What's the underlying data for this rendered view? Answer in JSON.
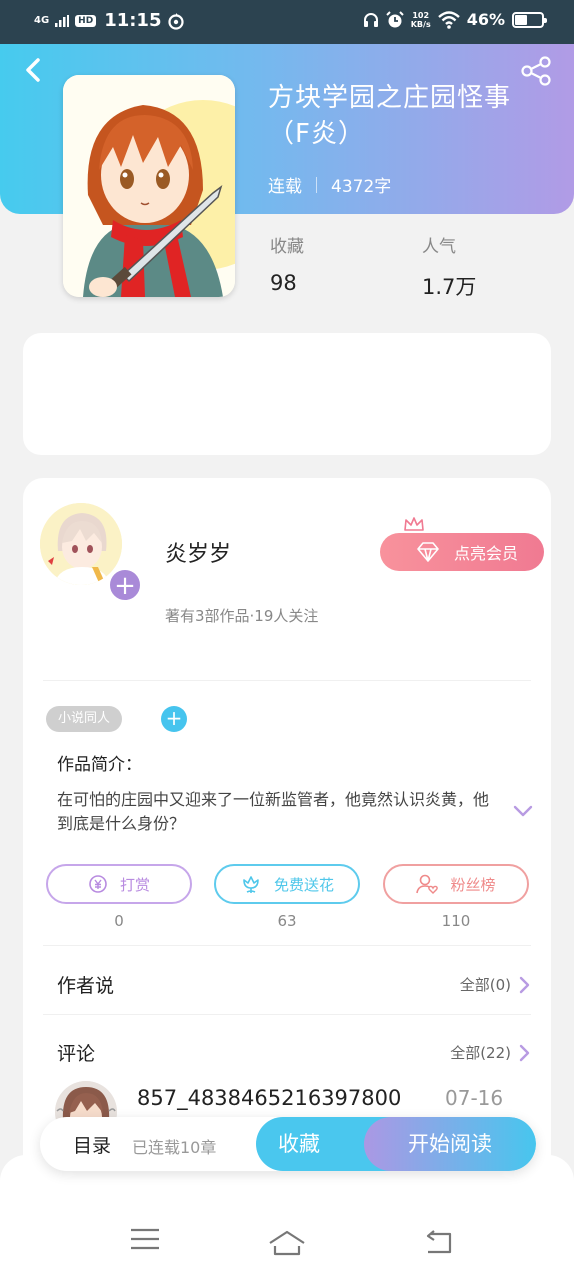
{
  "status_bar": {
    "signal": "4G",
    "hd": "HD",
    "time": "11:15",
    "net_speed_value": "102",
    "net_speed_unit": "KB/s",
    "battery_percent": "46%",
    "battery_level": 0.46
  },
  "book": {
    "title": "方块学园之庄园怪事（F炎）",
    "status": "连载",
    "word_count": "4372字",
    "stats": [
      {
        "label": "收藏",
        "value": "98"
      },
      {
        "label": "人气",
        "value": "1.7万"
      }
    ]
  },
  "author": {
    "name": "炎岁岁",
    "meta": "著有3部作品·19人关注",
    "vip_button": "点亮会员",
    "follow_plus": "+"
  },
  "tags": {
    "items": [
      "小说同人"
    ],
    "add": "+"
  },
  "intro": {
    "title": "作品简介：",
    "text": "在可怕的庄园中又迎来了一位新监管者，他竟然认识炎黄，他到底是什么身份？"
  },
  "actions": [
    {
      "label": "打赏",
      "count": "0",
      "color": "#b88be0"
    },
    {
      "label": "免费送花",
      "count": "63",
      "color": "#4fc7ea"
    },
    {
      "label": "粉丝榜",
      "count": "110",
      "color": "#ef8a8a"
    }
  ],
  "author_says": {
    "title": "作者说",
    "more": "全部(0)"
  },
  "comments": {
    "title": "评论",
    "more": "全部(22)",
    "first": {
      "user": "857_4838465216397800",
      "date": "07-16"
    }
  },
  "bottom_bar": {
    "catalog": "目录",
    "chapters": "已连载10章",
    "collect": "收藏",
    "read": "开始阅读"
  },
  "colors": {
    "header_start": "#46cbee",
    "header_end": "#b19be6",
    "accent_blue": "#4ac7ee",
    "accent_purple": "#ab98e4",
    "vip_pink": "#f07a92"
  }
}
